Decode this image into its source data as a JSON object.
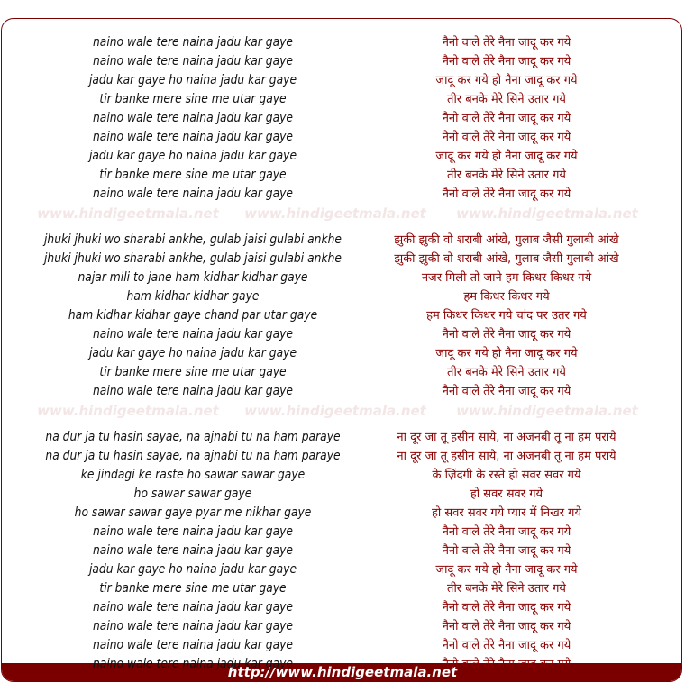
{
  "watermark": "www.hindigeetmala.net",
  "footer": "http://www.hindigeetmala.net",
  "colors": {
    "accent": "#7a0000",
    "hindi_text": "#8b0000",
    "watermark": "#f3e6e6"
  },
  "stanzas": [
    [
      [
        "naino wale tere naina jadu kar gaye",
        "नैनो वाले तेरे नैना जादू कर गये"
      ],
      [
        "naino wale tere naina jadu kar gaye",
        "नैनो वाले तेरे नैना जादू कर गये"
      ],
      [
        "jadu kar gaye ho naina jadu kar gaye",
        "जादू कर गये हो नैना जादू कर गये"
      ],
      [
        "tir banke mere sine me utar gaye",
        "तीर बनके मेरे सिने उतार गये"
      ],
      [
        "naino wale tere naina jadu kar gaye",
        "नैनो वाले तेरे नैना जादू कर गये"
      ],
      [
        "naino wale tere naina jadu kar gaye",
        "नैनो वाले तेरे नैना जादू कर गये"
      ],
      [
        "jadu kar gaye ho naina jadu kar gaye",
        "जादू कर गये हो नैना जादू कर गये"
      ],
      [
        "tir banke mere sine me utar gaye",
        "तीर बनके मेरे सिने उतार गये"
      ],
      [
        "naino wale tere naina jadu kar gaye",
        "नैनो वाले तेरे नैना जादू कर गये"
      ]
    ],
    [
      [
        "jhuki jhuki wo sharabi ankhe, gulab jaisi gulabi ankhe",
        "झुकी झुकी वो शराबी आंखे, गुलाब जैसी गुलाबी आंखे"
      ],
      [
        "jhuki jhuki wo sharabi ankhe, gulab jaisi gulabi ankhe",
        "झुकी झुकी वो शराबी आंखे, गुलाब जैसी गुलाबी आंखे"
      ],
      [
        "najar mili to jane ham kidhar kidhar gaye",
        "नजर मिली तो जाने हम किधर किधर गये"
      ],
      [
        "ham kidhar kidhar gaye",
        "हम किधर किधर गये"
      ],
      [
        "ham kidhar kidhar gaye chand par utar gaye",
        "हम किधर किधर गये चांद पर उतर गये"
      ],
      [
        "naino wale tere naina jadu kar gaye",
        "नैनो वाले तेरे नैना जादू कर गये"
      ],
      [
        "jadu kar gaye ho naina jadu kar gaye",
        "जादू कर गये हो नैना जादू कर गये"
      ],
      [
        "tir banke mere sine me utar gaye",
        "तीर बनके मेरे सिने उतार गये"
      ],
      [
        "naino wale tere naina jadu kar gaye",
        "नैनो वाले तेरे नैना जादू कर गये"
      ]
    ],
    [
      [
        "na dur ja tu hasin sayae, na ajnabi tu na ham paraye",
        "ना दूर जा तू हसीन साये, ना अजनबी तू ना हम पराये"
      ],
      [
        "na dur ja tu hasin sayae, na ajnabi tu na ham paraye",
        "ना दूर जा तू हसीन साये, ना अजनबी तू ना हम पराये"
      ],
      [
        "ke jindagi ke raste ho sawar sawar gaye",
        "के ज़िंदगी के रस्ते हो सवर सवर गये"
      ],
      [
        "ho sawar sawar gaye",
        "हो सवर सवर गये"
      ],
      [
        "ho sawar sawar gaye pyar me nikhar gaye",
        "हो सवर सवर गये प्यार में निखर गये"
      ],
      [
        "naino wale tere naina jadu kar gaye",
        "नैनो वाले तेरे नैना जादू कर गये"
      ],
      [
        "naino wale tere naina jadu kar gaye",
        "नैनो वाले तेरे नैना जादू कर गये"
      ],
      [
        "jadu kar gaye ho naina jadu kar gaye",
        "जादू कर गये हो नैना जादू कर गये"
      ],
      [
        "tir banke mere sine me utar gaye",
        "तीर बनके मेरे सिने उतार गये"
      ],
      [
        "naino wale tere naina jadu kar gaye",
        "नैनो वाले तेरे नैना जादू कर गये"
      ],
      [
        "naino wale tere naina jadu kar gaye",
        "नैनो वाले तेरे नैना जादू कर गये"
      ],
      [
        "naino wale tere naina jadu kar gaye",
        "नैनो वाले तेरे नैना जादू कर गये"
      ],
      [
        "naino wale tere naina jadu kar gaye",
        "नैनो वाले तेरे नैना जादू कर गये"
      ]
    ]
  ]
}
